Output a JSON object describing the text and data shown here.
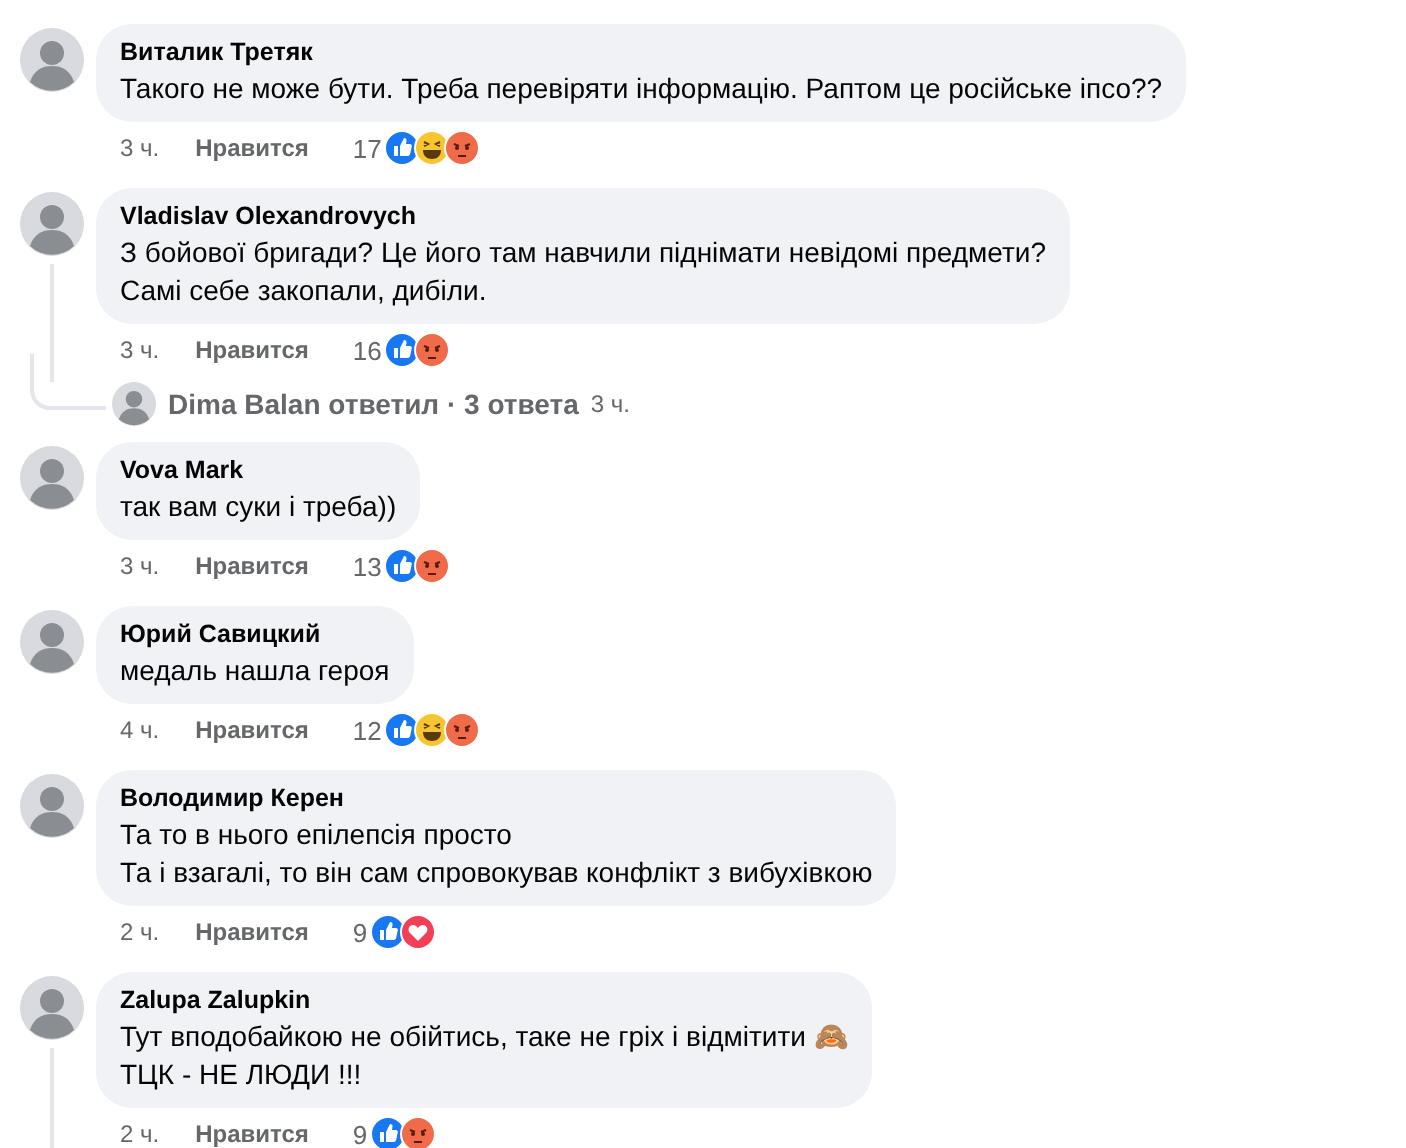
{
  "comments": [
    {
      "author": "Виталик Третяк",
      "lines": [
        "Такого не може бути. Треба перевіряти інформацію. Раптом це російське іпсо??"
      ],
      "time": "3 ч.",
      "like_label": "Нравится",
      "count": "17",
      "reactions": [
        {
          "kind": "like"
        },
        {
          "kind": "haha"
        },
        {
          "kind": "angry"
        }
      ],
      "has_replies": false
    },
    {
      "author": "Vladislav Olexandrovych",
      "lines": [
        "З бойової бригади? Це його там навчили піднімати невідомі предмети?",
        "Самі себе закопали, дибіли."
      ],
      "time": "3 ч.",
      "like_label": "Нравится",
      "count": "16",
      "reactions": [
        {
          "kind": "like"
        },
        {
          "kind": "angry"
        }
      ],
      "has_replies": true,
      "replies": {
        "text": "Dima Balan ответил · 3 ответа",
        "time": "3 ч."
      }
    },
    {
      "author": "Vova Mark",
      "lines": [
        "так вам суки і треба))"
      ],
      "time": "3 ч.",
      "like_label": "Нравится",
      "count": "13",
      "reactions": [
        {
          "kind": "like"
        },
        {
          "kind": "angry"
        }
      ],
      "has_replies": false
    },
    {
      "author": "Юрий Савицкий",
      "lines": [
        "медаль нашла героя"
      ],
      "time": "4 ч.",
      "like_label": "Нравится",
      "count": "12",
      "reactions": [
        {
          "kind": "like"
        },
        {
          "kind": "haha"
        },
        {
          "kind": "angry"
        }
      ],
      "has_replies": false
    },
    {
      "author": "Володимир Керен",
      "lines": [
        "Та то в нього епілепсія просто",
        "Та і взагалі, то він сам спровокував конфлікт з вибухівкою"
      ],
      "time": "2 ч.",
      "like_label": "Нравится",
      "count": "9",
      "reactions": [
        {
          "kind": "like"
        },
        {
          "kind": "love"
        }
      ],
      "has_replies": false
    },
    {
      "author": "Zalupa Zalupkin",
      "lines": [
        "Тут вподобайкою не обійтись, таке не гріх і відмітити 🙈",
        "ТЦК - НЕ ЛЮДИ !!!"
      ],
      "time": "2 ч.",
      "like_label": "Нравится",
      "count": "9",
      "reactions": [
        {
          "kind": "like"
        },
        {
          "kind": "angry"
        }
      ],
      "has_replies": true
    }
  ]
}
